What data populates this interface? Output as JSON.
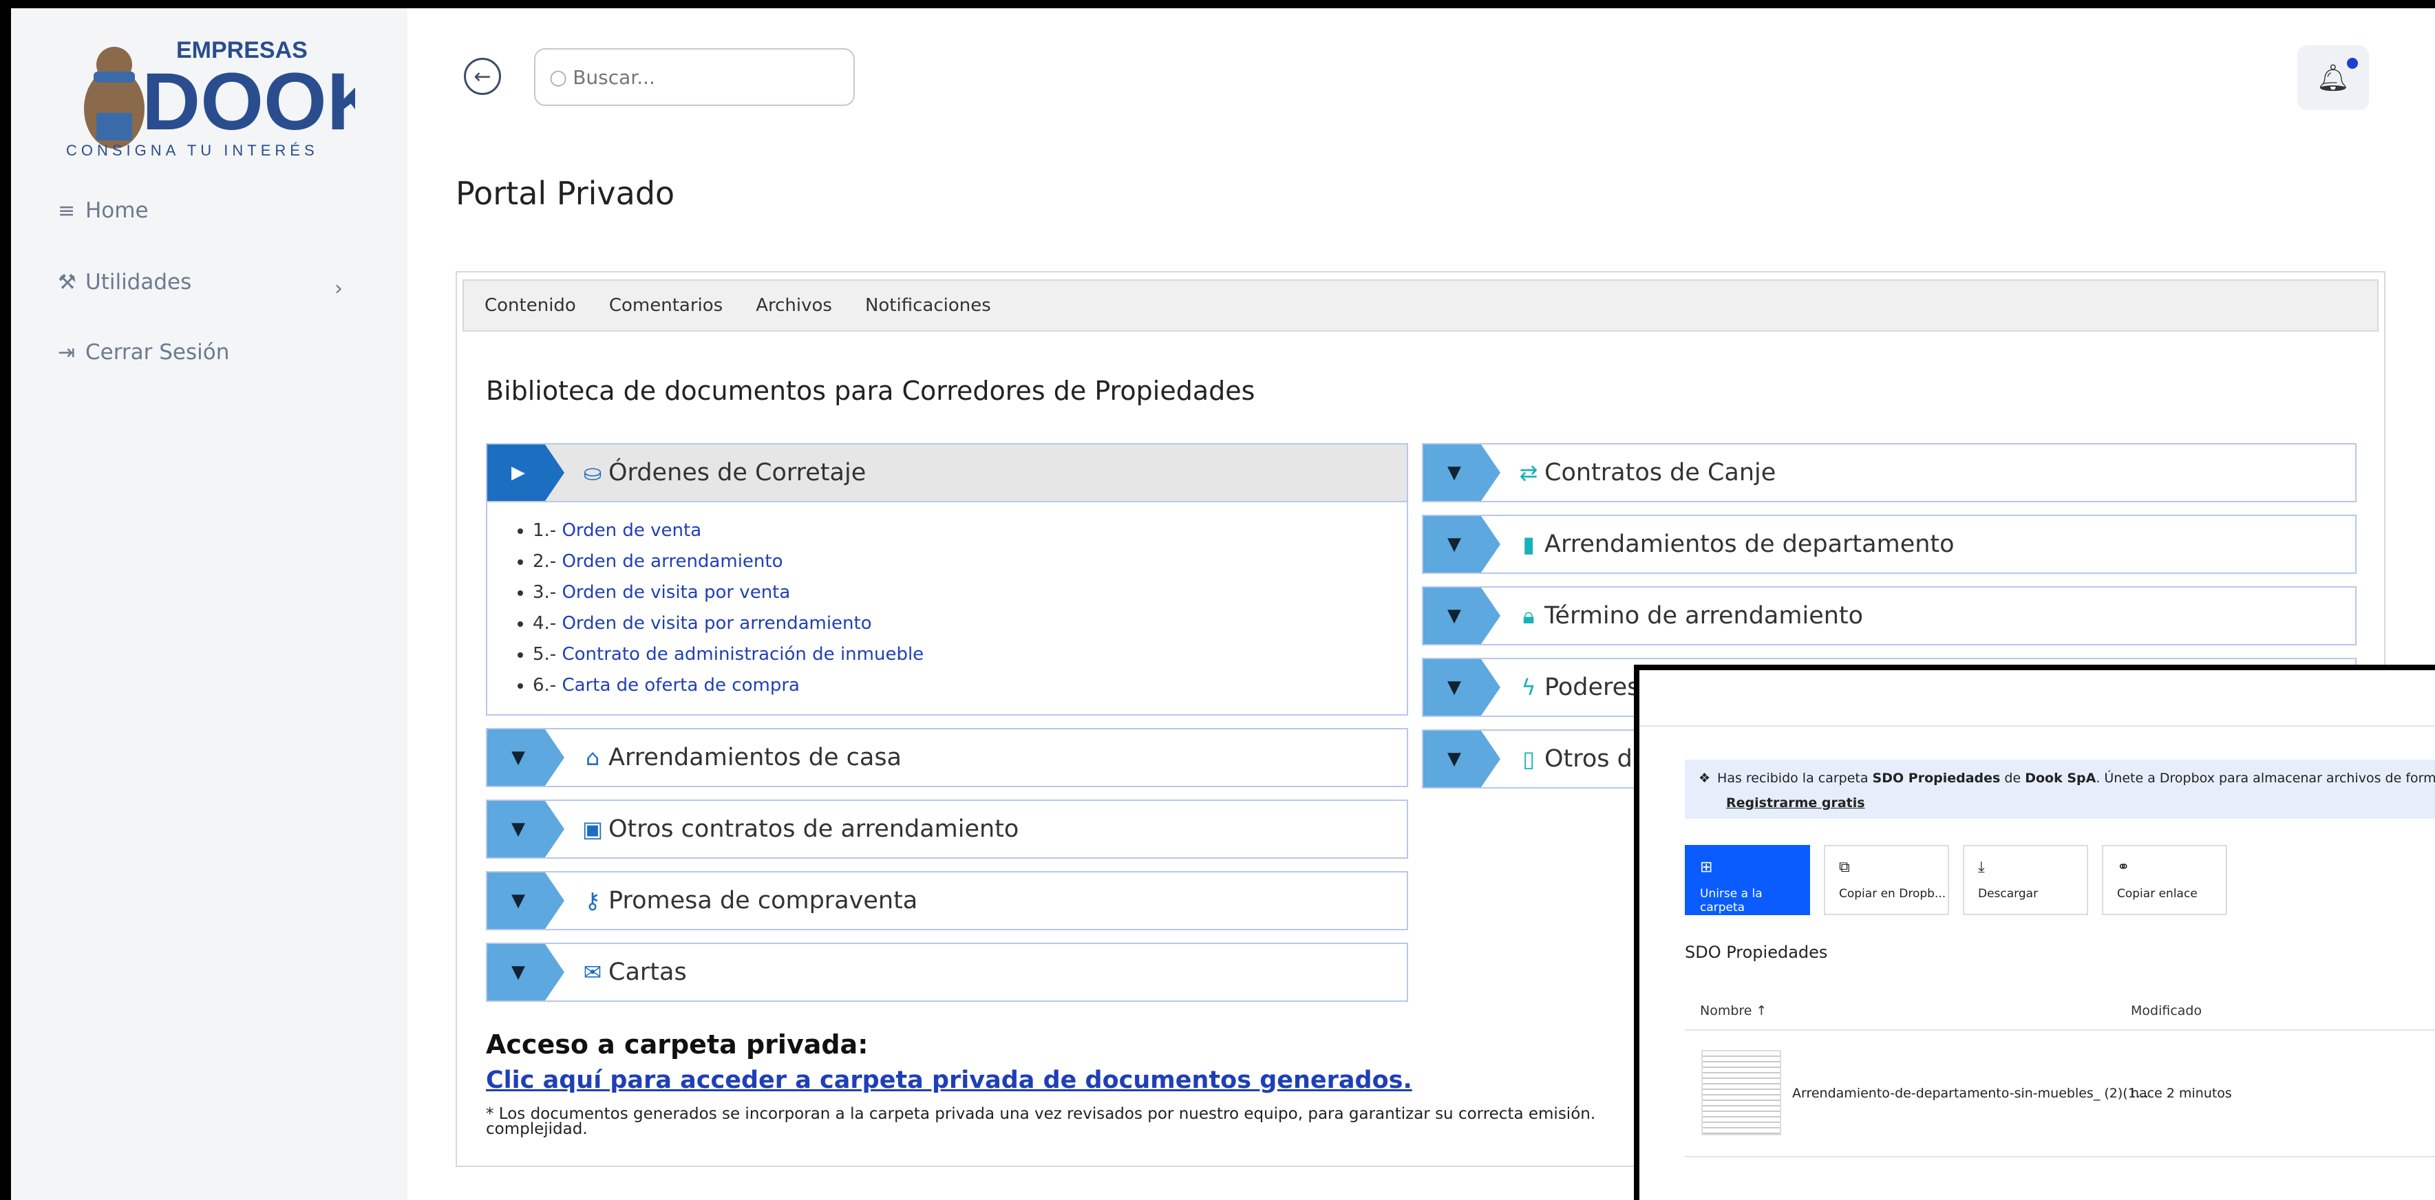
{
  "brand": {
    "logo_top": "EMPRESAS",
    "logo_main": "DOOK",
    "tagline": "CONSIGNA TU INTERÉS"
  },
  "sidebar": {
    "items": [
      {
        "label": "Home",
        "icon": "menu-icon"
      },
      {
        "label": "Utilidades",
        "icon": "tools-icon"
      },
      {
        "label": "Cerrar Sesión",
        "icon": "logout-icon"
      }
    ]
  },
  "header": {
    "search_placeholder": "Buscar..."
  },
  "page": {
    "title": "Portal Privado"
  },
  "tabs": [
    "Contenido",
    "Comentarios",
    "Archivos",
    "Notificaciones"
  ],
  "library": {
    "title": "Biblioteca de documentos para Corredores de Propiedades",
    "left": [
      {
        "label": "Órdenes de Corretaje",
        "icon": "stamp-icon",
        "color": "#1c6ec1"
      },
      {
        "label": "Arrendamientos de casa",
        "icon": "home-icon",
        "color": "#1c6ec1"
      },
      {
        "label": "Otros contratos de arrendamiento",
        "icon": "money-icon",
        "color": "#1c6ec1"
      },
      {
        "label": "Promesa de compraventa",
        "icon": "key-icon",
        "color": "#1c6ec1"
      },
      {
        "label": "Cartas",
        "icon": "envelope-icon",
        "color": "#1c6ec1"
      }
    ],
    "right": [
      {
        "label": "Contratos de Canje",
        "icon": "exchange-icon",
        "color": "#16b2b8"
      },
      {
        "label": "Arrendamientos de departamento",
        "icon": "building-icon",
        "color": "#16b2b8"
      },
      {
        "label": "Término de arrendamiento",
        "icon": "lock-icon",
        "color": "#16b2b8"
      },
      {
        "label": "Poderes",
        "icon": "bolt-icon",
        "color": "#16b2b8"
      },
      {
        "label": "Otros do",
        "icon": "file-icon",
        "color": "#16b2b8"
      }
    ],
    "open_items": [
      {
        "num": "1.-",
        "text": "Orden de venta"
      },
      {
        "num": "2.-",
        "text": "Orden de arrendamiento"
      },
      {
        "num": "3.-",
        "text": "Orden de visita por venta"
      },
      {
        "num": "4.-",
        "text": "Orden de visita por arrendamiento"
      },
      {
        "num": "5.-",
        "text": "Contrato de administración de inmueble"
      },
      {
        "num": "6.-",
        "text": "Carta de oferta de compra"
      }
    ]
  },
  "private": {
    "title": "Acceso a carpeta privada:",
    "link": "Clic aquí para acceder a carpeta privada de documentos generados.",
    "note": "* Los documentos generados se incorporan a la carpeta privada una vez revisados por nuestro equipo, para garantizar su correcta emisión.",
    "note2": "complejidad."
  },
  "dropbox": {
    "banner_pre": "Has recibido la carpeta ",
    "banner_folder": "SDO Propiedades",
    "banner_mid": " de ",
    "banner_owner": "Dook SpA",
    "banner_post": ". Únete a Dropbox para almacenar archivos de forma segura",
    "register": "Registrarme gratis",
    "buttons": [
      "Unirse a la carpeta",
      "Copiar en Dropb...",
      "Descargar",
      "Copiar enlace"
    ],
    "folder_name": "SDO Propiedades",
    "col_name": "Nombre ↑",
    "col_modified": "Modificado",
    "file_name": "Arrendamiento-de-departamento-sin-muebles_ (2)(1...",
    "file_modified": "hace 2 minutos"
  }
}
